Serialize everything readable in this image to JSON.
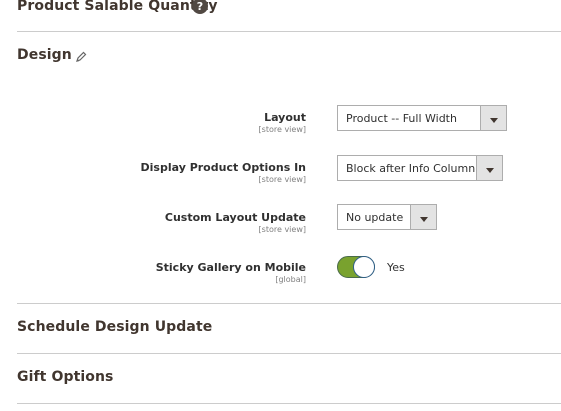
{
  "sections": {
    "salable_quantity": {
      "title": "Product Salable Quantity",
      "help_icon": "?"
    },
    "design": {
      "title": "Design"
    },
    "schedule_design_update": {
      "title": "Schedule Design Update"
    },
    "gift_options": {
      "title": "Gift Options"
    }
  },
  "design_fields": {
    "layout": {
      "label": "Layout",
      "scope": "[store view]",
      "value": "Product -- Full Width"
    },
    "display_options": {
      "label": "Display Product Options In",
      "scope": "[store view]",
      "value": "Block after Info Column"
    },
    "custom_layout": {
      "label": "Custom Layout Update",
      "scope": "[store view]",
      "value": "No update"
    },
    "sticky_gallery": {
      "label": "Sticky Gallery on Mobile",
      "scope": "[global]",
      "toggle_text": "Yes",
      "enabled": true
    }
  },
  "colors": {
    "toggle_on": "#79a22e",
    "title": "#41362f"
  },
  "icons": {
    "help": "help-icon",
    "edit": "pencil-icon",
    "dropdown": "chevron-down-icon"
  }
}
